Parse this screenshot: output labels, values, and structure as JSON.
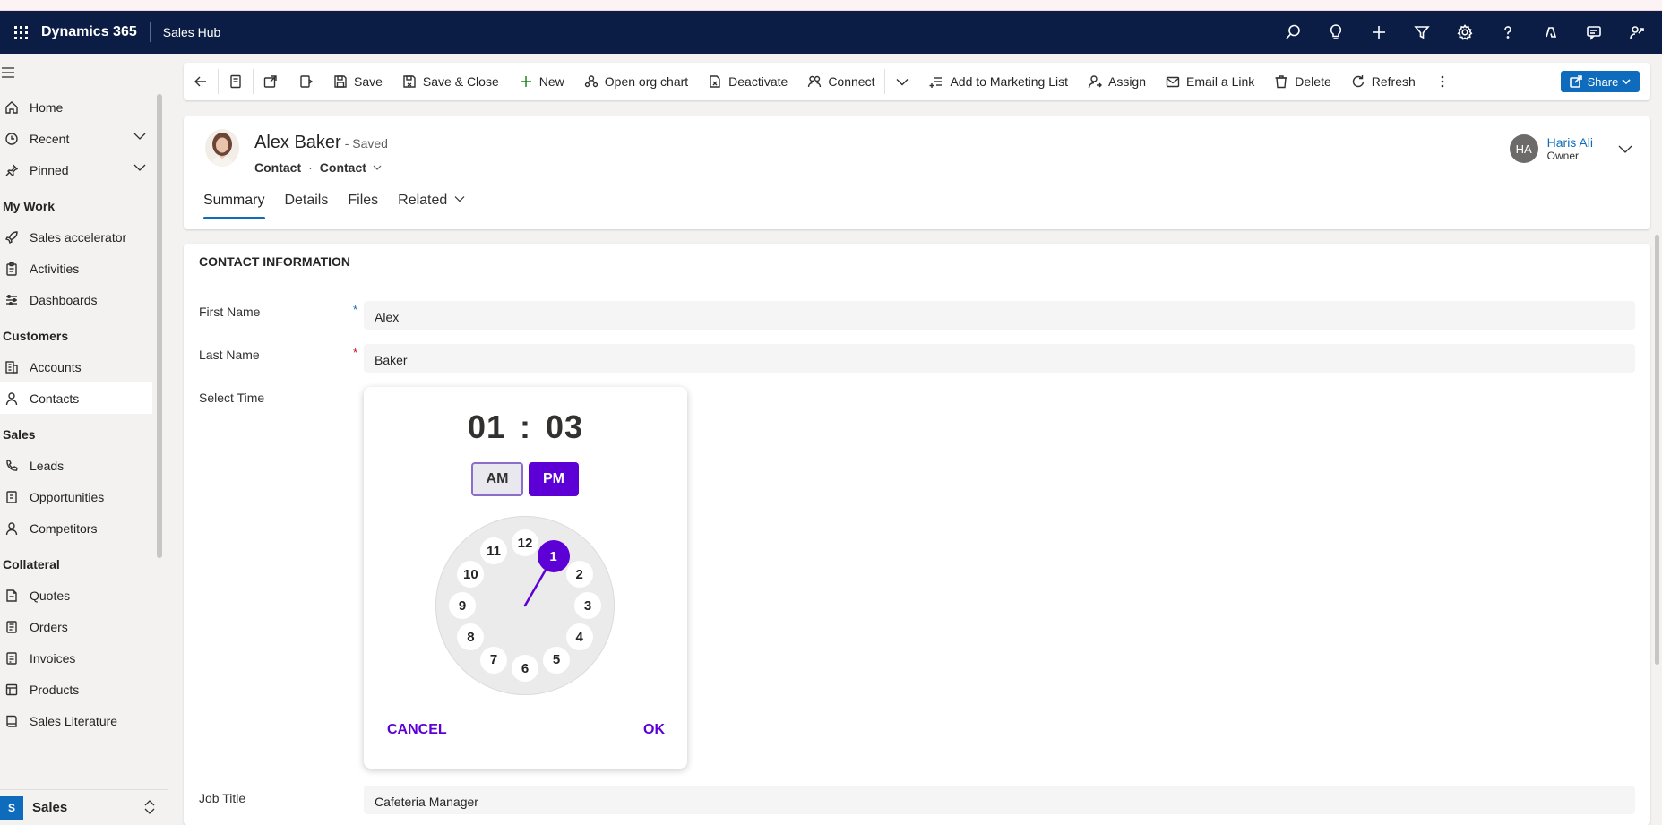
{
  "topbar": {
    "brand": "Dynamics 365",
    "app_name": "Sales Hub",
    "icons": [
      "search-icon",
      "lightbulb-icon",
      "plus-icon",
      "filter-icon",
      "settings-icon",
      "help-icon",
      "copilot-icon",
      "chat-icon",
      "assist-icon"
    ]
  },
  "sidebar": {
    "items_top": [
      {
        "label": "Home",
        "icon": "home-icon"
      },
      {
        "label": "Recent",
        "icon": "clock-icon",
        "expandable": true
      },
      {
        "label": "Pinned",
        "icon": "pin-icon",
        "expandable": true
      }
    ],
    "groups": [
      {
        "title": "My Work",
        "items": [
          {
            "label": "Sales accelerator",
            "icon": "rocket-icon"
          },
          {
            "label": "Activities",
            "icon": "clipboard-icon"
          },
          {
            "label": "Dashboards",
            "icon": "dashboard-icon"
          }
        ]
      },
      {
        "title": "Customers",
        "items": [
          {
            "label": "Accounts",
            "icon": "building-icon"
          },
          {
            "label": "Contacts",
            "icon": "person-icon",
            "active": true
          }
        ]
      },
      {
        "title": "Sales",
        "items": [
          {
            "label": "Leads",
            "icon": "phone-icon"
          },
          {
            "label": "Opportunities",
            "icon": "document-icon"
          },
          {
            "label": "Competitors",
            "icon": "person-icon"
          }
        ]
      },
      {
        "title": "Collateral",
        "items": [
          {
            "label": "Quotes",
            "icon": "document-icon"
          },
          {
            "label": "Orders",
            "icon": "box-icon"
          },
          {
            "label": "Invoices",
            "icon": "invoice-icon"
          },
          {
            "label": "Products",
            "icon": "product-icon"
          },
          {
            "label": "Sales Literature",
            "icon": "book-icon"
          }
        ]
      }
    ],
    "area": {
      "badge": "S",
      "label": "Sales"
    }
  },
  "commandbar": {
    "save": "Save",
    "save_close": "Save & Close",
    "new": "New",
    "org_chart": "Open org chart",
    "deactivate": "Deactivate",
    "connect": "Connect",
    "add_marketing": "Add to Marketing List",
    "assign": "Assign",
    "email_link": "Email a Link",
    "delete": "Delete",
    "refresh": "Refresh",
    "share": "Share"
  },
  "record": {
    "name": "Alex Baker",
    "status": "- Saved",
    "entity": "Contact",
    "form": "Contact",
    "owner_initials": "HA",
    "owner_name": "Haris Ali",
    "owner_role": "Owner",
    "tabs": [
      "Summary",
      "Details",
      "Files",
      "Related"
    ]
  },
  "form": {
    "section_title": "CONTACT INFORMATION",
    "first_name_label": "First Name",
    "first_name_value": "Alex",
    "last_name_label": "Last Name",
    "last_name_value": "Baker",
    "select_time_label": "Select Time",
    "job_title_label": "Job Title",
    "job_title_value": "Cafeteria Manager"
  },
  "time_picker": {
    "hour": "01",
    "minute": "03",
    "am": "AM",
    "pm": "PM",
    "selected_period": "PM",
    "selected_hour": 1,
    "cancel": "CANCEL",
    "ok": "OK",
    "accent_color": "#5c00d6",
    "numbers": [
      "12",
      "1",
      "2",
      "3",
      "4",
      "5",
      "6",
      "7",
      "8",
      "9",
      "10",
      "11"
    ]
  }
}
